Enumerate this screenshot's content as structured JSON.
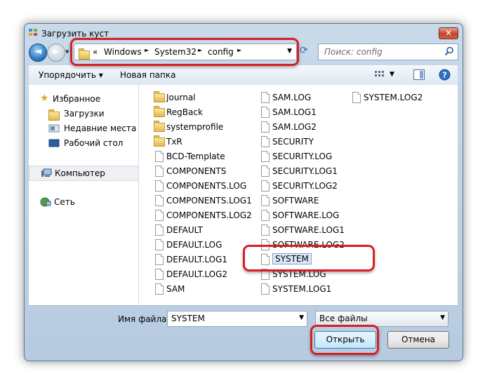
{
  "window": {
    "title": "Загрузить куст",
    "close_label": "✕"
  },
  "nav": {
    "back_icon": "back-arrow-icon",
    "forward_icon": "forward-arrow-icon"
  },
  "address": {
    "prefix": "«",
    "crumbs": [
      "Windows",
      "System32",
      "config"
    ],
    "arrows": [
      "►",
      "►",
      "►"
    ]
  },
  "search": {
    "placeholder": "Поиск: config"
  },
  "toolbar": {
    "organize_label": "Упорядочить ▾",
    "new_folder_label": "Новая папка"
  },
  "sidebar": {
    "favorites_label": "Избранное",
    "downloads_label": "Загрузки",
    "recent_label": "Недавние места",
    "desktop_label": "Рабочий стол",
    "computer_label": "Компьютер",
    "network_label": "Сеть"
  },
  "files": [
    {
      "name": "Journal",
      "type": "folder"
    },
    {
      "name": "RegBack",
      "type": "folder"
    },
    {
      "name": "systemprofile",
      "type": "folder"
    },
    {
      "name": "TxR",
      "type": "folder"
    },
    {
      "name": "BCD-Template",
      "type": "file"
    },
    {
      "name": "COMPONENTS",
      "type": "file"
    },
    {
      "name": "COMPONENTS.LOG",
      "type": "file"
    },
    {
      "name": "COMPONENTS.LOG1",
      "type": "file"
    },
    {
      "name": "COMPONENTS.LOG2",
      "type": "file"
    },
    {
      "name": "DEFAULT",
      "type": "file"
    },
    {
      "name": "DEFAULT.LOG",
      "type": "file"
    },
    {
      "name": "DEFAULT.LOG1",
      "type": "file"
    },
    {
      "name": "DEFAULT.LOG2",
      "type": "file"
    },
    {
      "name": "SAM",
      "type": "file"
    },
    {
      "name": "SAM.LOG",
      "type": "file"
    },
    {
      "name": "SAM.LOG1",
      "type": "file"
    },
    {
      "name": "SAM.LOG2",
      "type": "file"
    },
    {
      "name": "SECURITY",
      "type": "file"
    },
    {
      "name": "SECURITY.LOG",
      "type": "file"
    },
    {
      "name": "SECURITY.LOG1",
      "type": "file"
    },
    {
      "name": "SECURITY.LOG2",
      "type": "file"
    },
    {
      "name": "SOFTWARE",
      "type": "file"
    },
    {
      "name": "SOFTWARE.LOG",
      "type": "file"
    },
    {
      "name": "SOFTWARE.LOG1",
      "type": "file"
    },
    {
      "name": "SOFTWARE.LOG2",
      "type": "file"
    },
    {
      "name": "SYSTEM",
      "type": "file",
      "selected": true
    },
    {
      "name": "SYSTEM.LOG",
      "type": "file"
    },
    {
      "name": "SYSTEM.LOG1",
      "type": "file"
    },
    {
      "name": "SYSTEM.LOG2",
      "type": "file"
    }
  ],
  "footer": {
    "filename_label": "Имя файла:",
    "filename_value": "SYSTEM",
    "filetype_value": "Все файлы",
    "open_label": "Открыть",
    "cancel_label": "Отмена"
  },
  "highlight_color": "#d81f26"
}
